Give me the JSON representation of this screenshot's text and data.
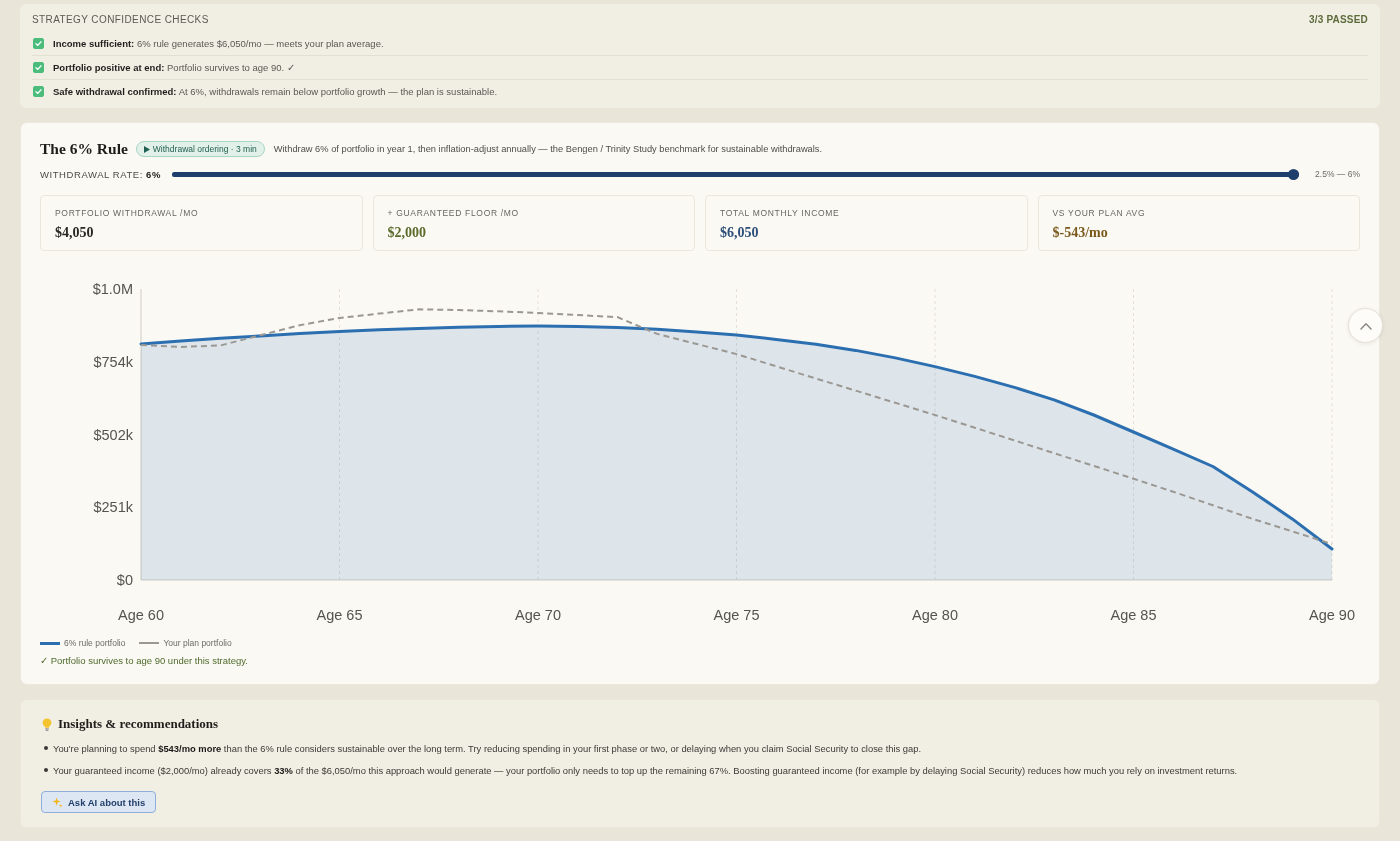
{
  "confidence_checks": {
    "title": "STRATEGY CONFIDENCE CHECKS",
    "summary": "3/3 PASSED",
    "items": [
      {
        "text": "**Income sufficient:** 6% rule generates $6,050/mo — meets your plan average.",
        "checked": true
      },
      {
        "text": "**Portfolio positive at end:** Portfolio survives to age 90. ✓",
        "checked": true
      },
      {
        "text": "**Safe withdrawal confirmed:** At 6%, withdrawals remain below portfolio growth — the plan is sustainable.",
        "checked": true
      }
    ]
  },
  "strategy": {
    "title": "The 6% Rule",
    "badge": "Withdrawal ordering · 3 min",
    "description": "Withdraw 6% of portfolio in year 1, then inflation-adjust annually — the Bengen / Trinity Study benchmark for sustainable withdrawals.",
    "withdrawal_rate": {
      "label": "WITHDRAWAL RATE: **6%**",
      "level": 1,
      "range": "2.5% — 6%"
    },
    "stats": [
      {
        "label": "PORTFOLIO WITHDRAWAL /MO",
        "value": "$4,050",
        "color": "#2a2926"
      },
      {
        "label": "+ GUARANTEED FLOOR /MO",
        "value": "$2,000",
        "color": "#5b6b2c"
      },
      {
        "label": "TOTAL MONTHLY INCOME",
        "value": "$6,050",
        "color": "#2d4e78"
      },
      {
        "label": "VS YOUR PLAN AVG",
        "value": "$-543/mo",
        "color": "#7a5a1c"
      }
    ],
    "chart_data": {
      "type": "area",
      "categories": [
        "Age 60",
        null,
        null,
        null,
        null,
        "Age 65",
        null,
        null,
        null,
        null,
        "Age 70",
        null,
        null,
        null,
        null,
        "Age 75",
        null,
        null,
        null,
        null,
        "Age 80",
        null,
        null,
        null,
        null,
        "Age 85",
        null,
        null,
        null,
        null,
        "Age 90"
      ],
      "ylim": [
        0,
        1005000
      ],
      "yticks": [
        {
          "value": 0,
          "label": "$0"
        },
        {
          "value": 251000,
          "label": "$251k"
        },
        {
          "value": 502000,
          "label": "$502k"
        },
        {
          "value": 754000,
          "label": "$754k"
        },
        {
          "value": 1005000,
          "label": "$1.0M"
        }
      ],
      "grid": true,
      "series": [
        {
          "name": "6% rule portfolio",
          "color": "#2c6fb0",
          "type": "area",
          "line_style": "solid",
          "values": [
            815000,
            825000,
            835000,
            843000,
            851000,
            858000,
            864000,
            869000,
            873000,
            876000,
            877000,
            876000,
            872000,
            866000,
            857000,
            846000,
            831000,
            814000,
            793000,
            767000,
            737000,
            703000,
            665000,
            622000,
            570000,
            511000,
            452000,
            392000,
            304000,
            211000,
            107000
          ]
        },
        {
          "name": "Your plan portfolio",
          "color": "#9b9893",
          "type": "line",
          "line_style": "dashed",
          "values": [
            812000,
            805000,
            810000,
            845000,
            880000,
            905000,
            920000,
            935000,
            932000,
            928000,
            922000,
            915000,
            908000,
            850000,
            815000,
            780000,
            738000,
            696000,
            654000,
            612000,
            570000,
            526000,
            482000,
            438000,
            394000,
            350000,
            305000,
            258000,
            211000,
            168000,
            124000
          ]
        }
      ]
    },
    "note": "✓ Portfolio survives to age 90 under this strategy."
  },
  "insights": {
    "title": "Insights & recommendations",
    "items": [
      "You're planning to spend **$543/mo more** than the 6% rule considers sustainable over the long term. Try reducing spending in your first phase or two, or delaying when you claim Social Security to close this gap.",
      "Your guaranteed income ($2,000/mo) already covers **33%** of the $6,050/mo this approach would generate — your portfolio only needs to top up the remaining 67%. Boosting guaranteed income (for example by delaying Social Security) reduces how much you rely on investment returns."
    ],
    "button": "Ask AI about this"
  }
}
